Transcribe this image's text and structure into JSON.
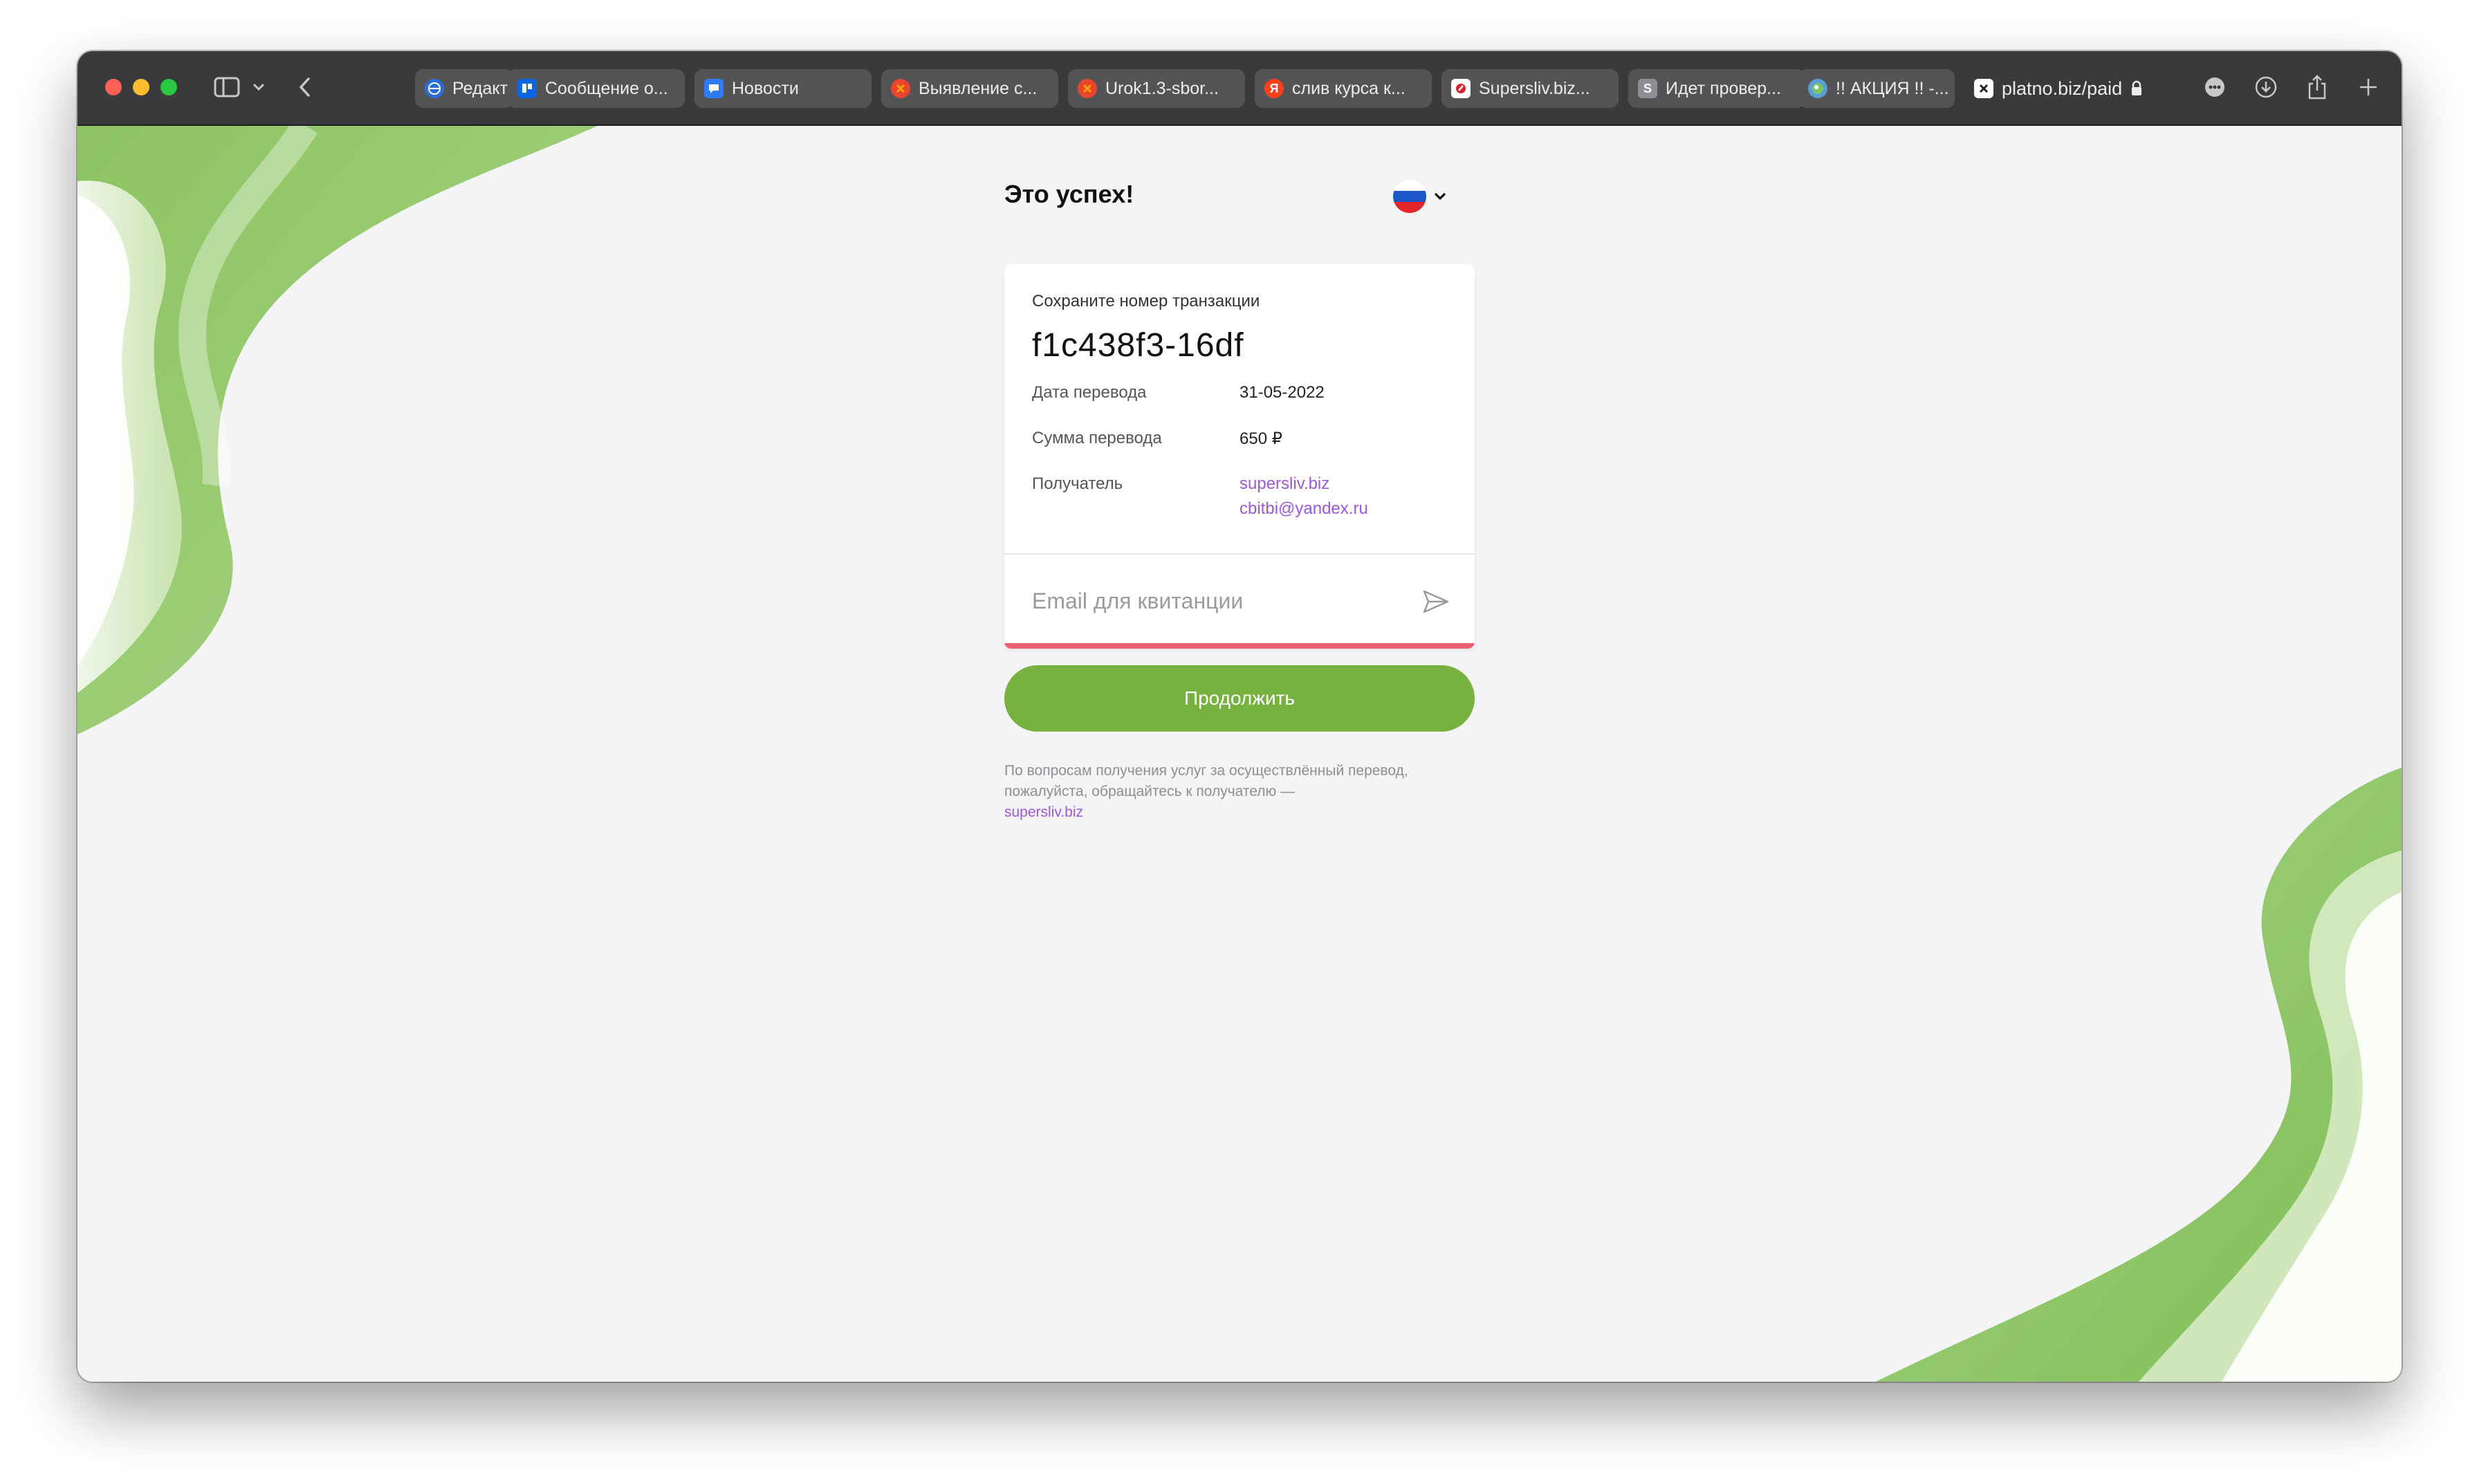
{
  "browser": {
    "tabs": [
      {
        "label": "Редакт",
        "icon": "globe-icon",
        "icon_color": "#2b6fd6"
      },
      {
        "label": "Сообщение о...",
        "icon": "trello-icon",
        "icon_color": "#0c66e4"
      },
      {
        "label": "Новости",
        "icon": "chat-icon",
        "icon_color": "#2d7cf6"
      },
      {
        "label": "Выявление с...",
        "icon": "x-icon",
        "icon_color": "#e8452c"
      },
      {
        "label": "Urok1.3-sbor...",
        "icon": "x-icon",
        "icon_color": "#e8452c"
      },
      {
        "label": "слив курса к...",
        "icon": "yandex-icon",
        "icon_color": "#fc3f1d"
      },
      {
        "label": "Supersliv.biz...",
        "icon": "supersliv-icon",
        "icon_color": "#ffffff"
      },
      {
        "label": "Идет провер...",
        "icon": "s-icon",
        "icon_color": "#8e8e93"
      },
      {
        "label": "!! АКЦИЯ !! -...",
        "icon": "globe-icon",
        "icon_color": "#5aa0d8"
      },
      {
        "label": "platno.biz/paid",
        "icon": "x-box-icon",
        "icon_color": "#ffffff",
        "active": true
      }
    ],
    "tab_letters": {
      "yandex": "Я",
      "s": "S"
    }
  },
  "page": {
    "title": "Это успех!",
    "language": "RU",
    "card": {
      "hint": "Сохраните номер транзакции",
      "transaction_id": "f1c438f3-16df",
      "date_label": "Дата перевода",
      "date_value": "31-05-2022",
      "amount_label": "Сумма перевода",
      "amount_value": "650 ₽",
      "recipient_label": "Получатель",
      "recipient_site": "supersliv.biz",
      "recipient_email": "cbitbi@yandex.ru",
      "email_placeholder": "Email для квитанции"
    },
    "continue_label": "Продолжить",
    "footnote_text": "По вопросам получения услуг за осуществлённый перевод, пожалуйста, обращайтесь к получателю —",
    "footnote_link": "supersliv.biz"
  },
  "colors": {
    "accent_green": "#77b140",
    "link_purple": "#9b59d6",
    "error_red": "#ee5f73",
    "toolbar": "#3a3a3c"
  }
}
